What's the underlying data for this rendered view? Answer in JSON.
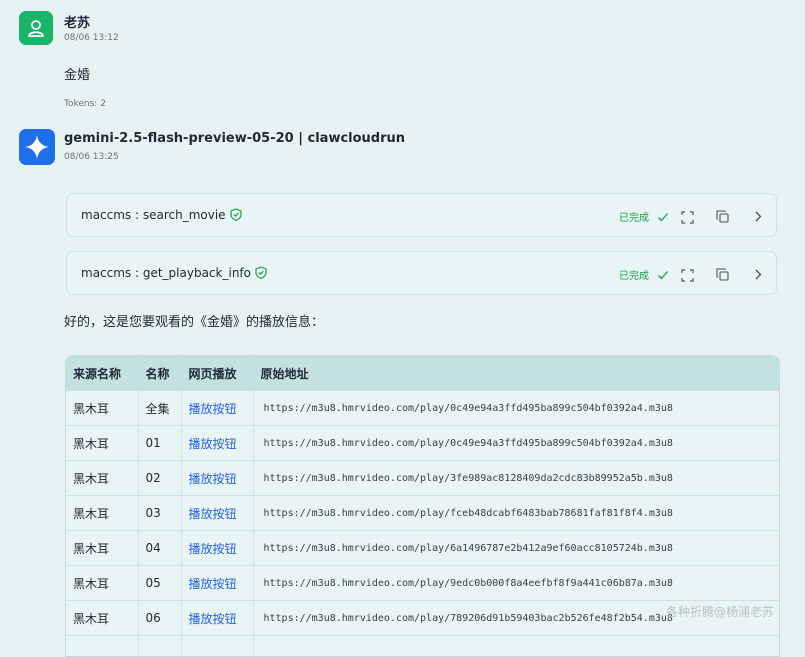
{
  "user_message": {
    "name": "老苏",
    "time": "08/06 13:12",
    "text": "金婚",
    "tokens": "Tokens: 2"
  },
  "bot_message": {
    "name": "gemini-2.5-flash-preview-05-20 | clawcloudrun",
    "time": "08/06 13:25",
    "tools": [
      {
        "name": "maccms : search_movie",
        "status": "已完成"
      },
      {
        "name": "maccms : get_playback_info",
        "status": "已完成"
      }
    ],
    "intro": "好的，这是您要观看的《金婚》的播放信息：",
    "table": {
      "headers": [
        "来源名称",
        "名称",
        "网页播放",
        "原始地址"
      ],
      "rows": [
        [
          "黑木耳",
          "全集",
          "播放按钮",
          "https://m3u8.hmrvideo.com/play/0c49e94a3ffd495ba899c504bf0392a4.m3u8"
        ],
        [
          "黑木耳",
          "01",
          "播放按钮",
          "https://m3u8.hmrvideo.com/play/0c49e94a3ffd495ba899c504bf0392a4.m3u8"
        ],
        [
          "黑木耳",
          "02",
          "播放按钮",
          "https://m3u8.hmrvideo.com/play/3fe989ac8128409da2cdc83b89952a5b.m3u8"
        ],
        [
          "黑木耳",
          "03",
          "播放按钮",
          "https://m3u8.hmrvideo.com/play/fceb48dcabf6483bab78681faf81f8f4.m3u8"
        ],
        [
          "黑木耳",
          "04",
          "播放按钮",
          "https://m3u8.hmrvideo.com/play/6a1496787e2b412a9ef60acc8105724b.m3u8"
        ],
        [
          "黑木耳",
          "05",
          "播放按钮",
          "https://m3u8.hmrvideo.com/play/9edc0b000f8a4eefbf8f9a441c06b87a.m3u8"
        ],
        [
          "黑木耳",
          "06",
          "播放按钮",
          "https://m3u8.hmrvideo.com/play/789206d91b59403bac2b526fe48f2b54.m3u8"
        ],
        [
          "",
          "",
          "",
          ""
        ]
      ]
    }
  },
  "watermark": "各种折腾@杨浦老苏",
  "colors": {
    "user_avatar": "#18b56a",
    "bot_avatar": "#1f6feb",
    "status": "#16a34a",
    "link": "#2563eb"
  }
}
